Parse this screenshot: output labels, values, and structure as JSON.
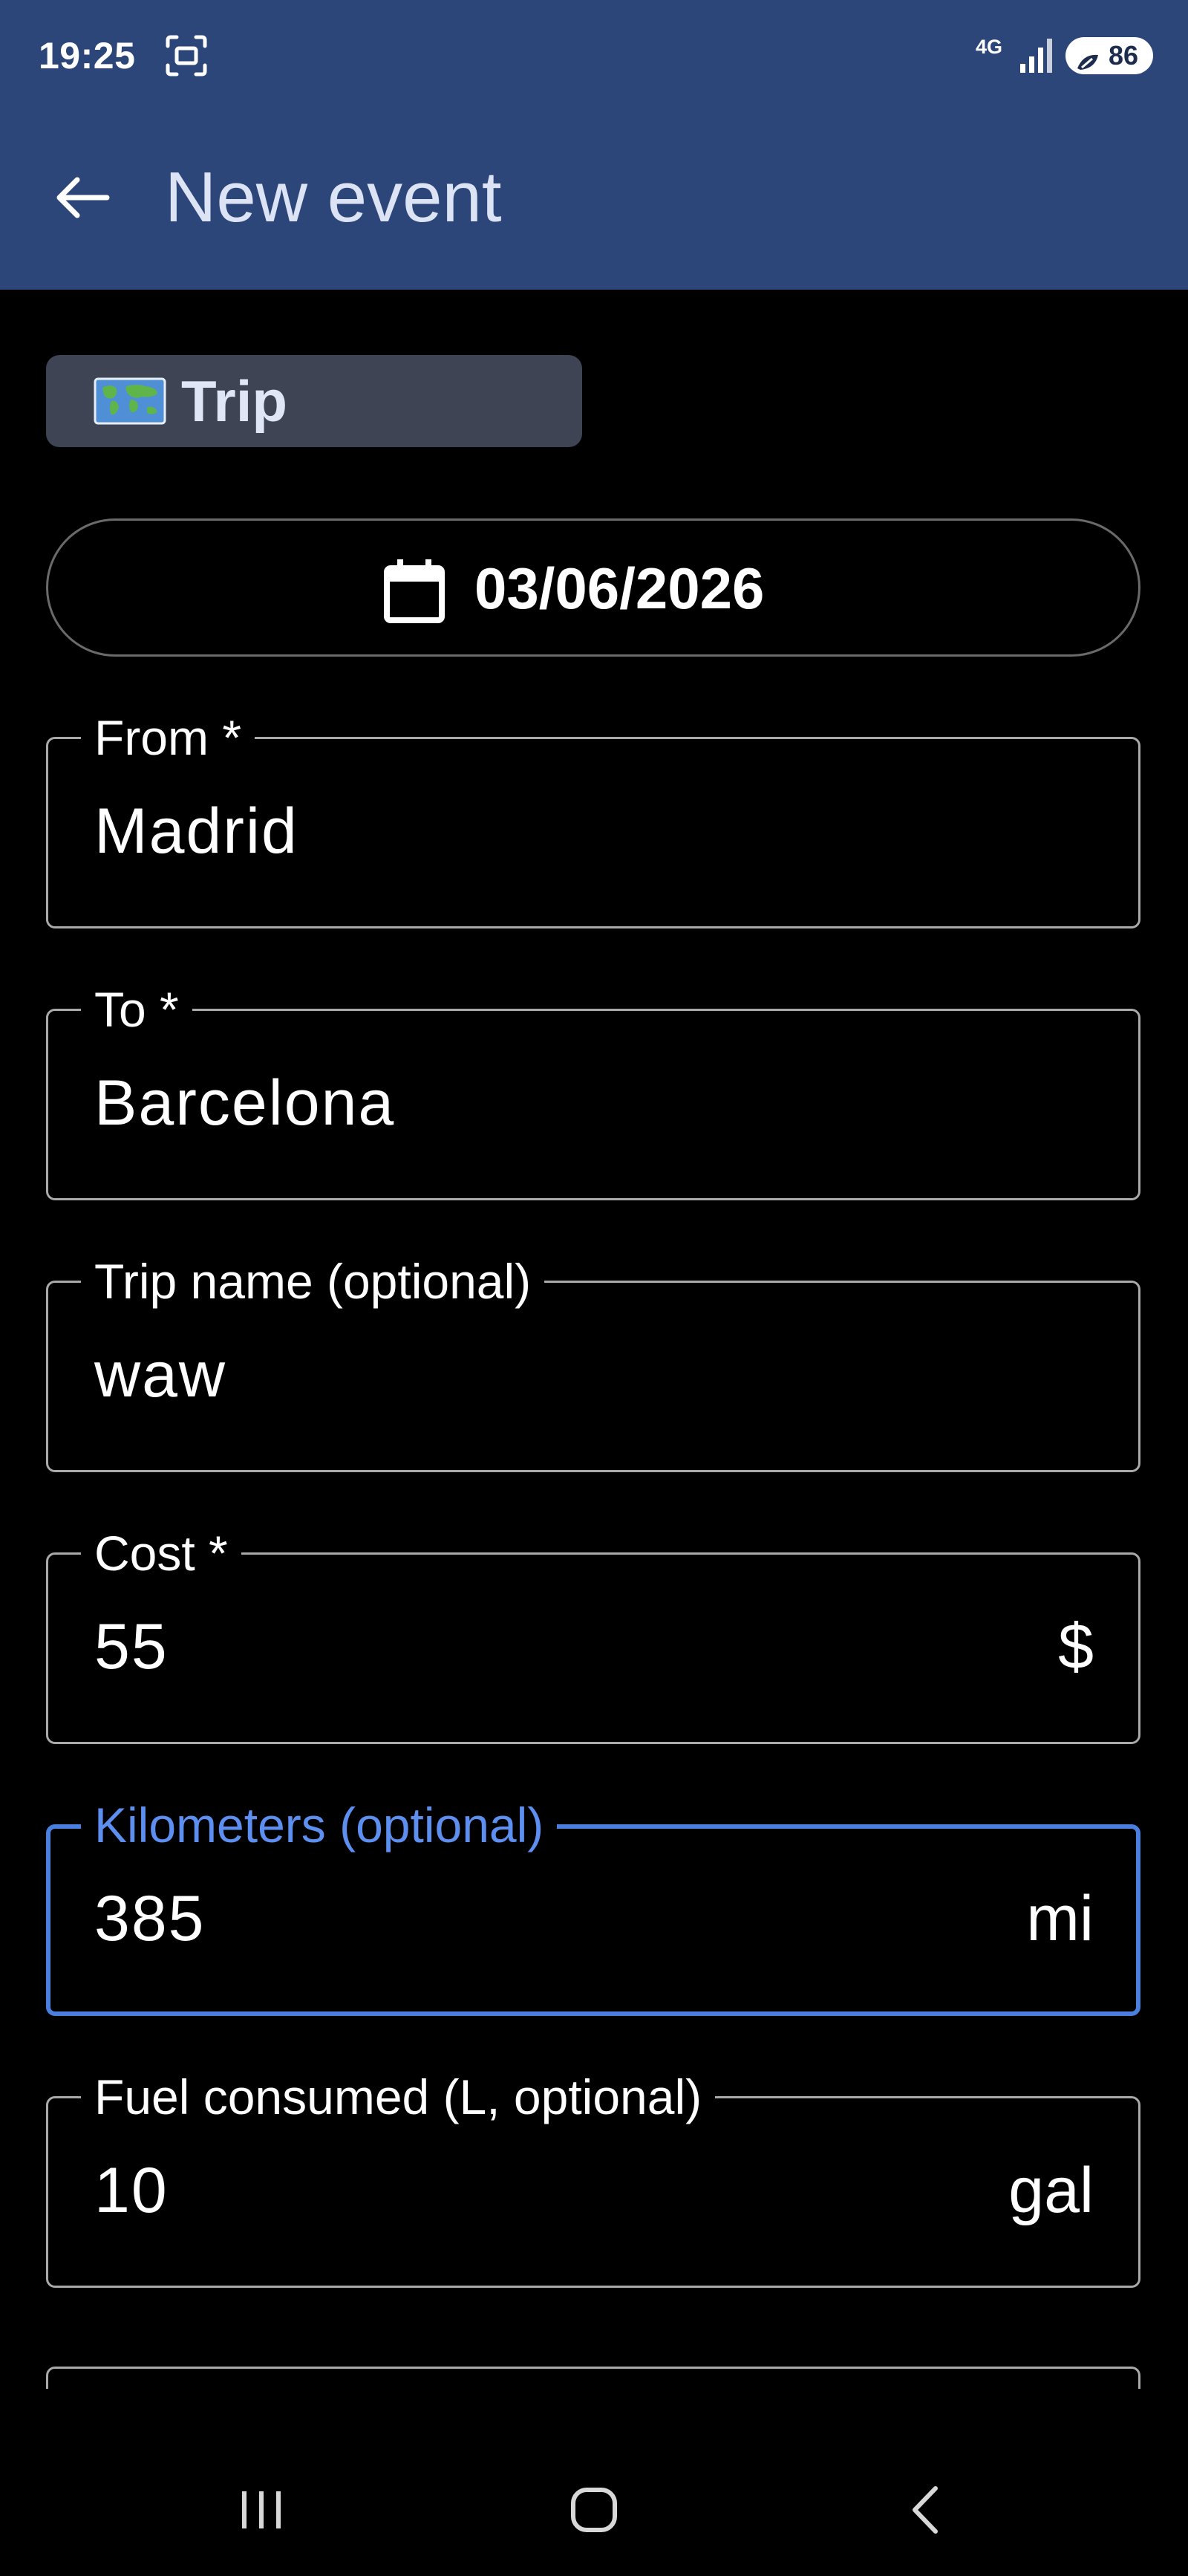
{
  "status_bar": {
    "time": "19:25",
    "network": "4G",
    "battery": "86",
    "icons": [
      "screenshot-icon",
      "signal-icon",
      "battery-saver-bolt-icon"
    ]
  },
  "app_bar": {
    "title": "New event",
    "back_icon": "arrow-left-icon"
  },
  "category": {
    "icon": "world-map-emoji-icon",
    "label": "Trip"
  },
  "date": {
    "icon": "calendar-icon",
    "value": "03/06/2026"
  },
  "fields": {
    "from": {
      "label": "From *",
      "value": "Madrid"
    },
    "to": {
      "label": "To *",
      "value": "Barcelona"
    },
    "trip_name": {
      "label": "Trip name (optional)",
      "value": "waw"
    },
    "cost": {
      "label": "Cost *",
      "value": "55",
      "suffix": "$"
    },
    "kilometers": {
      "label": "Kilometers (optional)",
      "value": "385",
      "suffix": "mi",
      "focused": true
    },
    "fuel": {
      "label": "Fuel consumed (L, optional)",
      "value": "10",
      "suffix": "gal"
    }
  },
  "nav_bar": {
    "icons": [
      "recent-apps-icon",
      "home-icon",
      "back-icon"
    ]
  },
  "colors": {
    "app_bar_bg": "#2d4679",
    "background": "#000000",
    "chip_bg": "#3e4453",
    "focus_accent": "#4a7fe0",
    "field_border": "#a9a9a9"
  }
}
